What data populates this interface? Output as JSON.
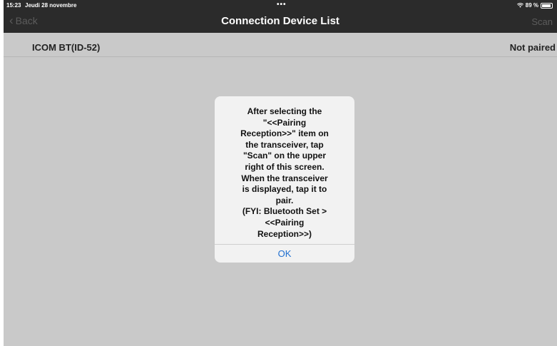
{
  "status_bar": {
    "time": "15:23",
    "date": "Jeudi 28 novembre",
    "dots": "•••",
    "wifi_icon": "wifi-icon",
    "battery": "89 %",
    "battery_level": 0.89
  },
  "nav": {
    "back_label": "Back",
    "title": "Connection Device List",
    "scan_label": "Scan"
  },
  "devices": [
    {
      "name": "ICOM BT(ID-52)",
      "status": "Not paired"
    }
  ],
  "alert": {
    "message": "After selecting the\n\"<<Pairing\nReception>>\" item on\nthe transceiver, tap\n\"Scan\" on the upper\nright of this screen.\nWhen the transceiver\nis displayed, tap it to\npair.\n(FYI: Bluetooth Set >\n<<Pairing\nReception>>)",
    "ok_label": "OK"
  },
  "colors": {
    "bar": "#2b2b2b",
    "background": "#c9c9c9",
    "link": "#1f6fd0"
  }
}
